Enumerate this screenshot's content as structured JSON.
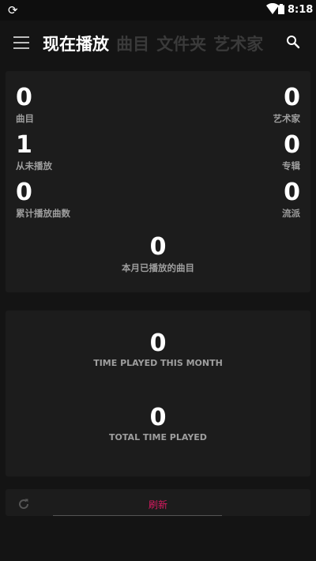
{
  "status_bar": {
    "time": "8:18"
  },
  "app_bar": {
    "tabs": [
      {
        "label": "现在播放",
        "active": true
      },
      {
        "label": "曲目",
        "active": false
      },
      {
        "label": "文件夹",
        "active": false
      },
      {
        "label": "艺术家",
        "active": false
      }
    ]
  },
  "stats": {
    "tracks": {
      "value": "0",
      "label": "曲目"
    },
    "artists": {
      "value": "0",
      "label": "艺术家"
    },
    "never_played": {
      "value": "1",
      "label": "从未播放"
    },
    "albums": {
      "value": "0",
      "label": "专辑"
    },
    "total_plays": {
      "value": "0",
      "label": "累计播放曲数"
    },
    "genres": {
      "value": "0",
      "label": "流派"
    },
    "played_this_month": {
      "value": "0",
      "label": "本月已播放的曲目"
    }
  },
  "time_stats": {
    "this_month": {
      "value": "0",
      "label": "TIME PLAYED THIS MONTH"
    },
    "total": {
      "value": "0",
      "label": "TOTAL TIME PLAYED"
    }
  },
  "refresh": {
    "label": "刷新"
  },
  "colors": {
    "accent": "#d81b60",
    "card": "#1c1c1c",
    "background": "#141414"
  }
}
